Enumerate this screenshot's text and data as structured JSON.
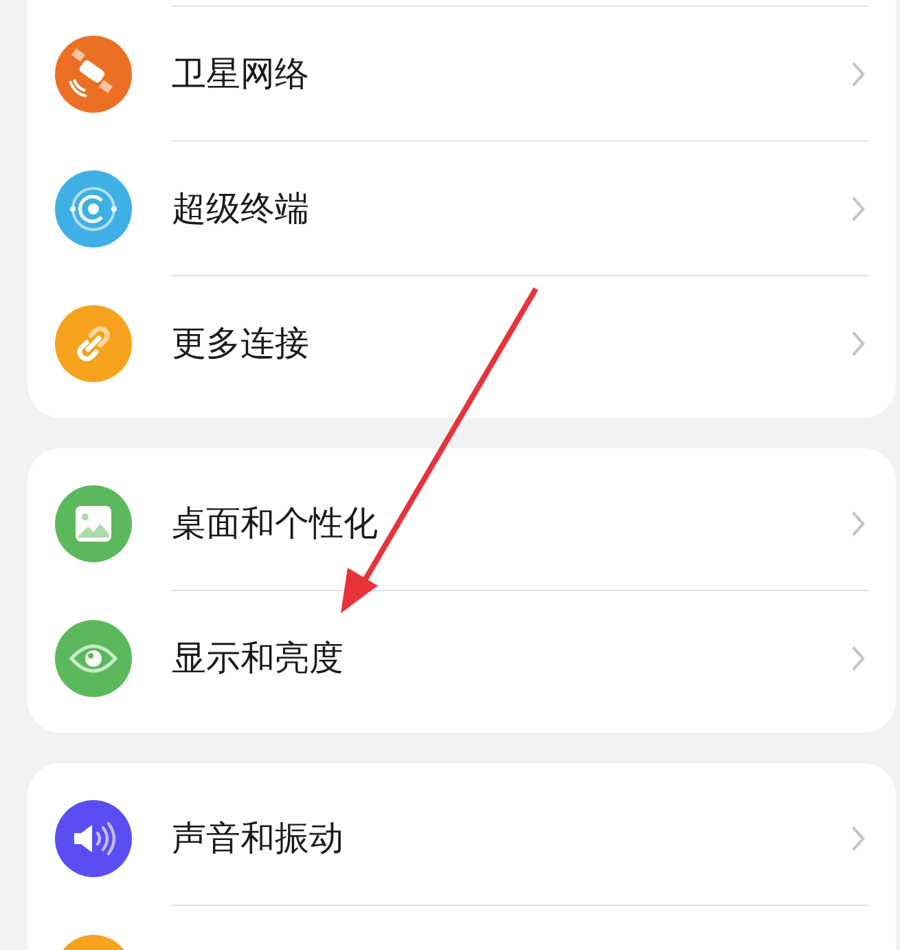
{
  "groups": [
    {
      "items": [
        {
          "kind": "satellite",
          "label": "卫星网络"
        },
        {
          "kind": "superdevice",
          "label": "超级终端"
        },
        {
          "kind": "link",
          "label": "更多连接"
        }
      ]
    },
    {
      "items": [
        {
          "kind": "image",
          "label": "桌面和个性化"
        },
        {
          "kind": "eye",
          "label": "显示和亮度"
        }
      ]
    },
    {
      "items": [
        {
          "kind": "sound",
          "label": "声音和振动"
        },
        {
          "kind": "orange"
        }
      ]
    }
  ],
  "annotation": {
    "kind": "arrow"
  }
}
